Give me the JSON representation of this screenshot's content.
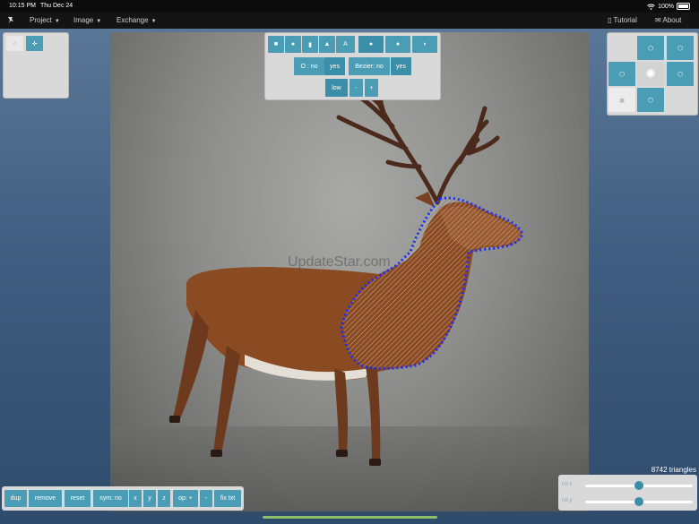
{
  "status": {
    "time": "10:15 PM",
    "date": "Thu Dec 24",
    "battery": "100%"
  },
  "menu": {
    "project": "Project",
    "image": "Image",
    "exchange": "Exchange",
    "tutorial": "Tutorial",
    "about": "About"
  },
  "image": {
    "watermark": "UpdateStar.com"
  },
  "toolbar": {
    "text_tool": "A",
    "o_no": "O : no",
    "o_yes": "yes",
    "bezier_no": "Bezier: no",
    "bezier_yes": "yes",
    "quality": "low",
    "minus": "-",
    "plus": "+"
  },
  "bottom": {
    "dup": "dup",
    "remove": "remove",
    "reset": "reset",
    "sym": "sym: no",
    "x": "x",
    "y": "y",
    "z": "z",
    "op": "op: +",
    "op_minus": "-",
    "fix": "fix txt"
  },
  "triangles": "8742 triangles",
  "sliders": {
    "a_label": "rot x",
    "b_label": "rot y",
    "a_value": 0.5,
    "b_value": 0.5
  },
  "colors": {
    "accent": "#4a9db5",
    "outline": "#1a2cff"
  }
}
